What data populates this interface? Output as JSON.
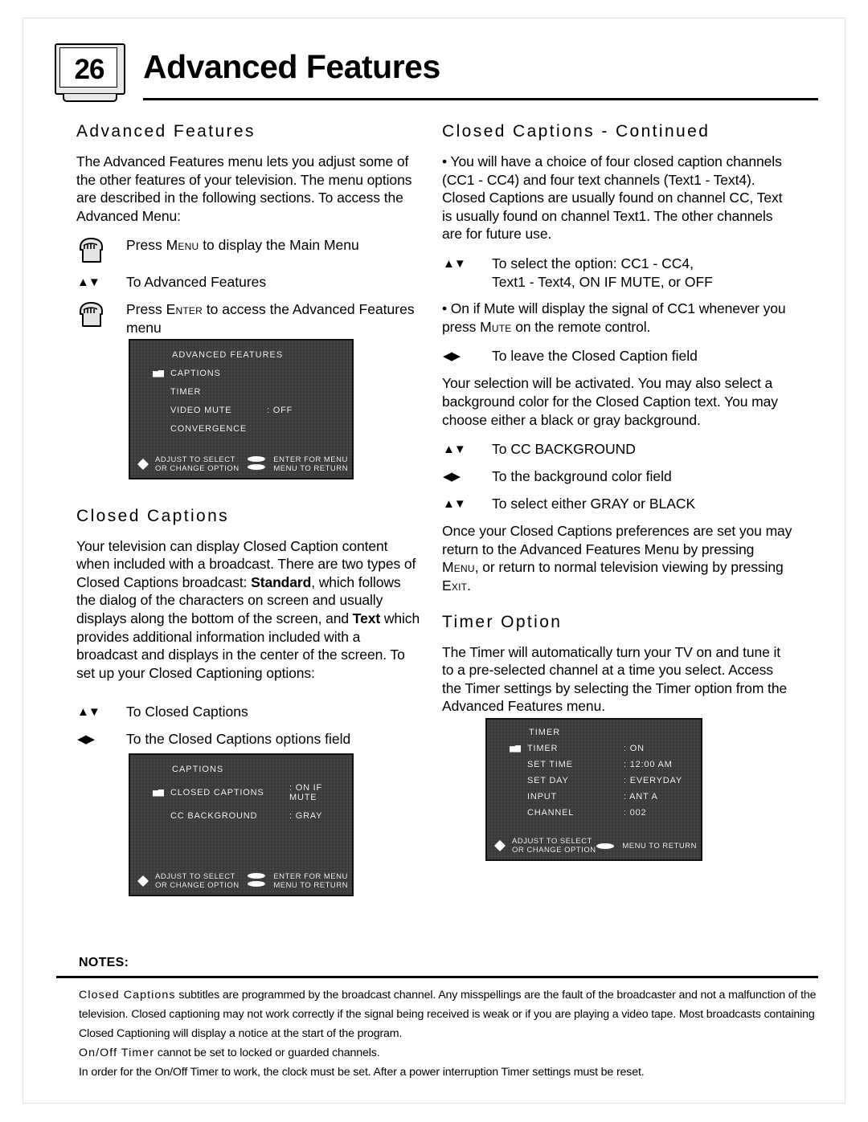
{
  "page": {
    "number": "26",
    "title": "Advanced Features"
  },
  "left_column": {
    "section1_heading": "Advanced Features",
    "section1_body": "The Advanced Features menu lets you adjust some of the other features of your television. The menu options are described in the following sections. To access the Advanced Menu:",
    "steps": [
      {
        "icon": "hand-press-icon",
        "text_pre": "Press ",
        "key": "Menu",
        "text_post": " to display the Main Menu"
      },
      {
        "icon": "up-down-arrows-icon",
        "text": "To Advanced Features"
      },
      {
        "icon": "hand-press-icon",
        "text_pre": "Press ",
        "key": "Enter",
        "text_post": " to access the Advanced Features menu"
      }
    ],
    "section2_heading": "Closed Captions",
    "section2_body_1": "Your television can display Closed Caption content when included with a broadcast. There are two types of Closed Captions broadcast: ",
    "section2_bold_1": "Standard",
    "section2_body_2": ", which follows the dialog of the characters on screen and usually displays along the bottom of the screen, and ",
    "section2_bold_2": "Text",
    "section2_body_3": " which provides additional information included with a broadcast and displays in the center of the screen. To set up your Closed Captioning options:",
    "steps2": [
      {
        "icon": "up-down-arrows-icon",
        "text": "To Closed Captions"
      },
      {
        "icon": "left-right-arrows-icon",
        "text": "To the Closed Captions options field"
      }
    ]
  },
  "right_column": {
    "section1_heading": "Closed Captions - Continued",
    "section1_body": "• You will have a choice of four closed caption channels (CC1 - CC4) and four text channels (Text1 - Text4). Closed Captions are usually found on channel CC, Text is usually found on channel Text1. The other channels are for future use.",
    "step_select": {
      "icon": "up-down-arrows-icon",
      "line1": "To select the option: CC1 - CC4,",
      "line2": "Text1 - Text4, ON IF MUTE, or OFF"
    },
    "body_mute_pre": "• On if Mute will display the signal of CC1 whenever you press ",
    "body_mute_key": "Mute",
    "body_mute_post": " on the remote control.",
    "step_leave": {
      "icon": "left-right-arrows-icon",
      "text": "To leave the Closed Caption field"
    },
    "body_selection": "Your selection will be activated. You may also select a background color for the Closed Caption text. You may choose either a black or gray background.",
    "steps_bg": [
      {
        "icon": "up-down-arrows-icon",
        "text": "To CC BACKGROUND"
      },
      {
        "icon": "left-right-arrows-icon",
        "text": "To the background color field"
      },
      {
        "icon": "up-down-arrows-icon",
        "text": "To select either GRAY or BLACK"
      }
    ],
    "body_once_pre": "Once your Closed Captions preferences are set you may return to the Advanced Features Menu by pressing ",
    "body_once_key1": "Menu",
    "body_once_mid": ", or return to normal television viewing by pressing ",
    "body_once_key2": "Exit",
    "body_once_post": ".",
    "section2_heading": "Timer Option",
    "section2_body": "The Timer will automatically turn your TV on and tune it to a pre-selected channel at a time you select. Access the Timer settings by selecting the Timer option from the Advanced Features menu."
  },
  "osd_advanced": {
    "title": "ADVANCED FEATURES",
    "rows": [
      {
        "cursor": true,
        "label": "CAPTIONS",
        "value": ""
      },
      {
        "cursor": false,
        "label": "TIMER",
        "value": ""
      },
      {
        "cursor": false,
        "label": "VIDEO MUTE",
        "value": ": OFF"
      },
      {
        "cursor": false,
        "label": "CONVERGENCE",
        "value": ""
      }
    ],
    "footer_left": "ADJUST  TO SELECT\nOR CHANGE OPTION",
    "footer_right": "ENTER FOR MENU\nMENU TO RETURN"
  },
  "osd_captions": {
    "title": "CAPTIONS",
    "rows": [
      {
        "cursor": true,
        "label": "CLOSED CAPTIONS",
        "value": ": ON IF MUTE"
      },
      {
        "cursor": false,
        "label": "CC BACKGROUND",
        "value": ": GRAY"
      }
    ],
    "footer_left": "ADJUST  TO SELECT\nOR CHANGE OPTION",
    "footer_right": "ENTER FOR MENU\nMENU TO RETURN"
  },
  "osd_timer": {
    "title": "TIMER",
    "rows": [
      {
        "cursor": true,
        "label": "TIMER",
        "value": ": ON"
      },
      {
        "cursor": false,
        "label": "SET TIME",
        "value": ": 12:00 AM"
      },
      {
        "cursor": false,
        "label": "SET DAY",
        "value": ": EVERYDAY"
      },
      {
        "cursor": false,
        "label": "INPUT",
        "value": ": ANT A"
      },
      {
        "cursor": false,
        "label": "CHANNEL",
        "value": ": 002"
      }
    ],
    "footer_left": "ADJUST  TO SELECT\nOR CHANGE OPTION",
    "footer_right": "MENU TO RETURN"
  },
  "notes": {
    "title": "NOTES:",
    "line1_em": "Closed Captions",
    "line1_rest": " subtitles are programmed by the broadcast channel. Any misspellings are the fault of the broadcaster and not a malfunction of the television. Closed captioning may not work correctly if the signal being received is weak or if you are playing a video tape. Most broadcasts containing Closed Captioning will display a notice at the start of the program.",
    "line2_em": "On/Off Timer",
    "line2_rest": " cannot be set to locked or guarded channels.",
    "line3": "In order for the On/Off Timer to work, the clock must be set. After a power interruption Timer settings must be reset."
  },
  "icons": {
    "up_down": "▲▼",
    "left_right": "◀▶"
  },
  "colors": {
    "osd_bg": "#3b3b3b",
    "osd_text": "#ffffff",
    "rule": "#000000"
  }
}
